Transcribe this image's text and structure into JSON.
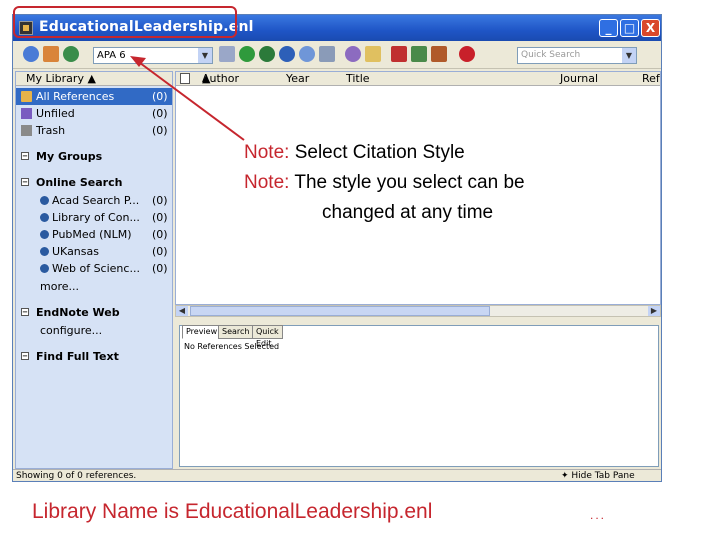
{
  "window": {
    "title": "EducationalLeadership.enl",
    "min": "_",
    "max": "□",
    "close": "X"
  },
  "toolbar": {
    "style_value": "APA 6",
    "quick_search_placeholder": "Quick Search"
  },
  "left_pane": {
    "header": "My Library",
    "library_items": [
      {
        "label": "All References",
        "count": "(0)"
      },
      {
        "label": "Unfiled",
        "count": "(0)"
      },
      {
        "label": "Trash",
        "count": "(0)"
      }
    ],
    "groups": [
      {
        "label": "My Groups"
      },
      {
        "label": "Online Search"
      },
      {
        "label": "EndNote Web"
      },
      {
        "label": "Find Full Text"
      }
    ],
    "online_search": [
      {
        "label": "Acad Search P...",
        "count": "(0)"
      },
      {
        "label": "Library of Con...",
        "count": "(0)"
      },
      {
        "label": "PubMed (NLM)",
        "count": "(0)"
      },
      {
        "label": "UKansas",
        "count": "(0)"
      },
      {
        "label": "Web of Scienc...",
        "count": "(0)"
      }
    ],
    "more": "more...",
    "configure": "configure..."
  },
  "grid": {
    "columns": [
      "Author",
      "Year",
      "Title",
      "Journal",
      "Ref"
    ]
  },
  "preview": {
    "tabs": [
      "Preview",
      "Search",
      "Quick Edit"
    ],
    "text": "No References Selected"
  },
  "status": {
    "text": "Showing 0 of 0 references.",
    "hide_tab": "Hide Tab Pane"
  },
  "annotations": {
    "note_label": "Note:",
    "note1": " Select Citation Style",
    "note2": " The style you select can be",
    "note2b": "changed at any time",
    "caption": "Library Name is EducationalLeadership.enl",
    "dots": "..."
  },
  "colors": {
    "accent_red": "#c6262e",
    "titlebar_blue": "#1f55c6",
    "selection_blue": "#316ac5"
  }
}
